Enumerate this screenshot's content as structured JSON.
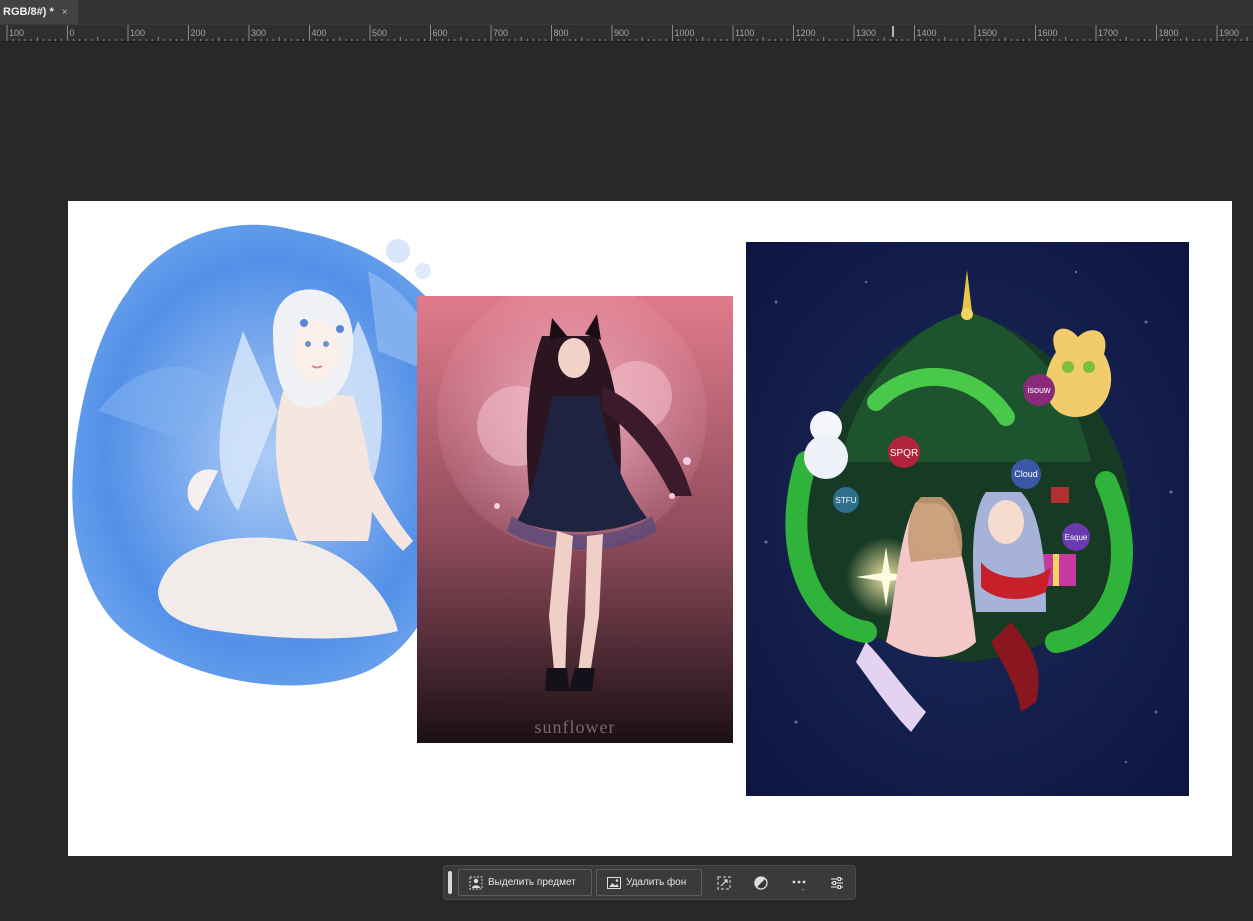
{
  "tab": {
    "title": "RGB/8#) *",
    "close": "×"
  },
  "ruler": {
    "labels": [
      "100",
      "0",
      "100",
      "200",
      "300",
      "400",
      "500",
      "600",
      "700",
      "800",
      "900",
      "1000",
      "1100",
      "1200",
      "1300",
      "1400",
      "1500",
      "1600",
      "1700",
      "1800",
      "1900"
    ]
  },
  "artworks": {
    "middle_watermark": "sunflower",
    "ornaments": [
      "SPQR",
      "isouw",
      "Cloud",
      "STFU",
      "Esque"
    ]
  },
  "contextbar": {
    "select_subject": "Выделить предмет",
    "remove_background": "Удалить фон"
  },
  "icons": {
    "select_subject": "person-select-icon",
    "remove_background": "image-icon",
    "transform": "transform-icon",
    "mask": "half-circle-icon",
    "more": "ellipsis-icon",
    "settings": "sliders-icon"
  }
}
